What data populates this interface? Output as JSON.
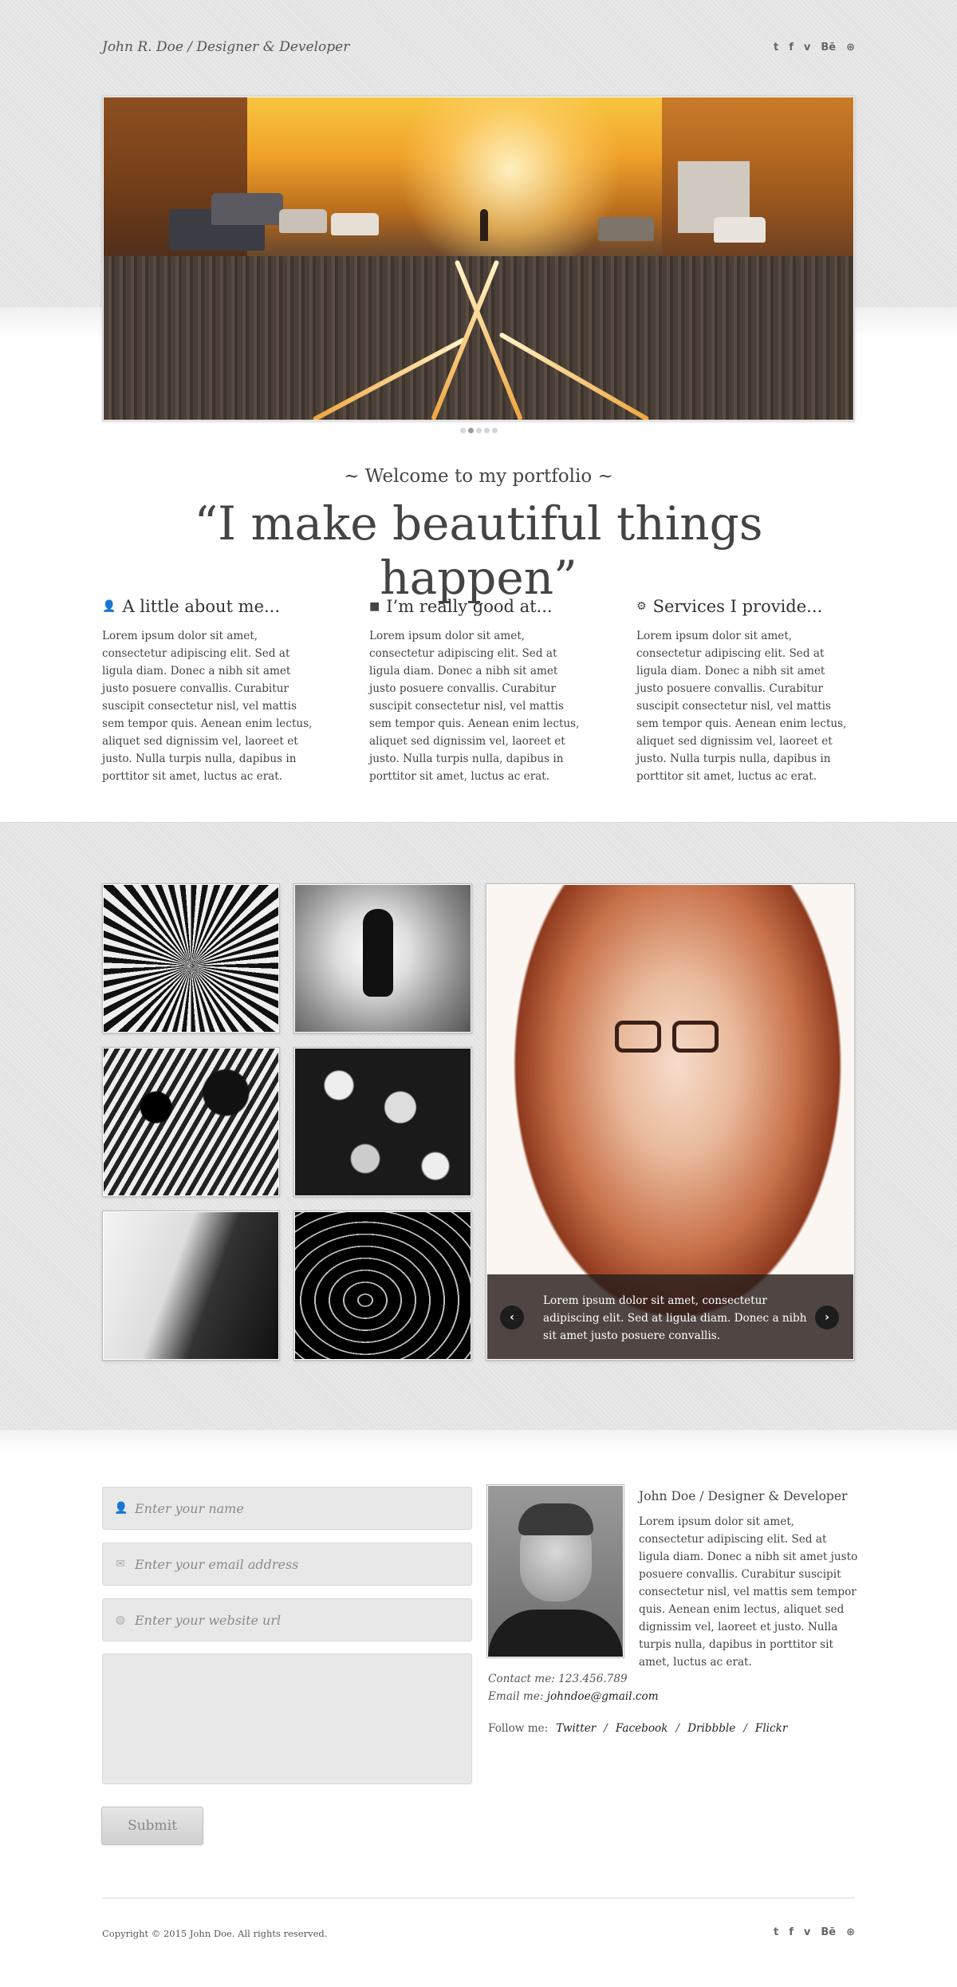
{
  "header": {
    "site_title": "John R. Doe / Designer & Developer",
    "social": [
      {
        "icon": "twitter-icon",
        "glyph": "t"
      },
      {
        "icon": "facebook-icon",
        "glyph": "f"
      },
      {
        "icon": "vimeo-icon",
        "glyph": "v"
      },
      {
        "icon": "behance-icon",
        "glyph": "Bē"
      },
      {
        "icon": "dribbble-icon",
        "glyph": "⊛"
      }
    ]
  },
  "slider": {
    "total_slides": 5,
    "active_slide": 2
  },
  "intro": {
    "subtitle": "~ Welcome to my portfolio ~",
    "quote": "“I make beautiful things happen”"
  },
  "columns": [
    {
      "icon": "user-icon",
      "glyph": "👤",
      "heading": "A little about me...",
      "text": "Lorem ipsum dolor sit amet, consectetur adipiscing elit. Sed at ligula diam. Donec a nibh sit amet justo posuere convallis. Curabitur suscipit consectetur nisl, vel mattis sem tempor quis. Aenean enim lectus, aliquet sed dignissim vel, laoreet et justo. Nulla turpis nulla, dapibus in porttitor sit amet, luctus ac erat."
    },
    {
      "icon": "comment-icon",
      "glyph": "■",
      "heading": "I’m really good at...",
      "text": "Lorem ipsum dolor sit amet, consectetur adipiscing elit. Sed at ligula diam. Donec a nibh sit amet justo posuere convallis. Curabitur suscipit consectetur nisl, vel mattis sem tempor quis. Aenean enim lectus, aliquet sed dignissim vel, laoreet et justo. Nulla turpis nulla, dapibus in porttitor sit amet, luctus ac erat."
    },
    {
      "icon": "gear-icon",
      "glyph": "⚙",
      "heading": "Services I provide...",
      "text": "Lorem ipsum dolor sit amet, consectetur adipiscing elit. Sed at ligula diam. Donec a nibh sit amet justo posuere convallis. Curabitur suscipit consectetur nisl, vel mattis sem tempor quis. Aenean enim lectus, aliquet sed dignissim vel, laoreet et justo. Nulla turpis nulla, dapibus in porttitor sit amet, luctus ac erat."
    }
  ],
  "gallery": {
    "caption": "Lorem ipsum dolor sit amet, consectetur adipiscing elit. Sed at ligula diam. Donec a nibh sit amet justo posuere convallis.",
    "prev_label": "‹",
    "next_label": "›"
  },
  "contact_form": {
    "name_placeholder": "Enter your name",
    "email_placeholder": "Enter your email address",
    "website_placeholder": "Enter your website url",
    "submit_label": "Submit"
  },
  "bio": {
    "title": "John Doe / Designer & Developer",
    "text": "Lorem ipsum dolor sit amet, consectetur adipiscing elit. Sed at ligula diam. Donec a nibh sit amet justo posuere convallis. Curabitur suscipit consectetur nisl, vel mattis sem tempor quis. Aenean enim lectus, aliquet sed dignissim vel, laoreet et justo. Nulla turpis nulla, dapibus in porttitor sit amet, luctus ac erat.",
    "contact_label": "Contact me: ",
    "phone": "123.456.789",
    "email_label": "Email me: ",
    "email": "johndoe@gmail.com",
    "follow_label": "Follow me:",
    "links": [
      "Twitter",
      "Facebook",
      "Dribbble",
      "Flickr"
    ]
  },
  "footer": {
    "copyright": "Copyright © 2015 John Doe. All rights reserved."
  }
}
